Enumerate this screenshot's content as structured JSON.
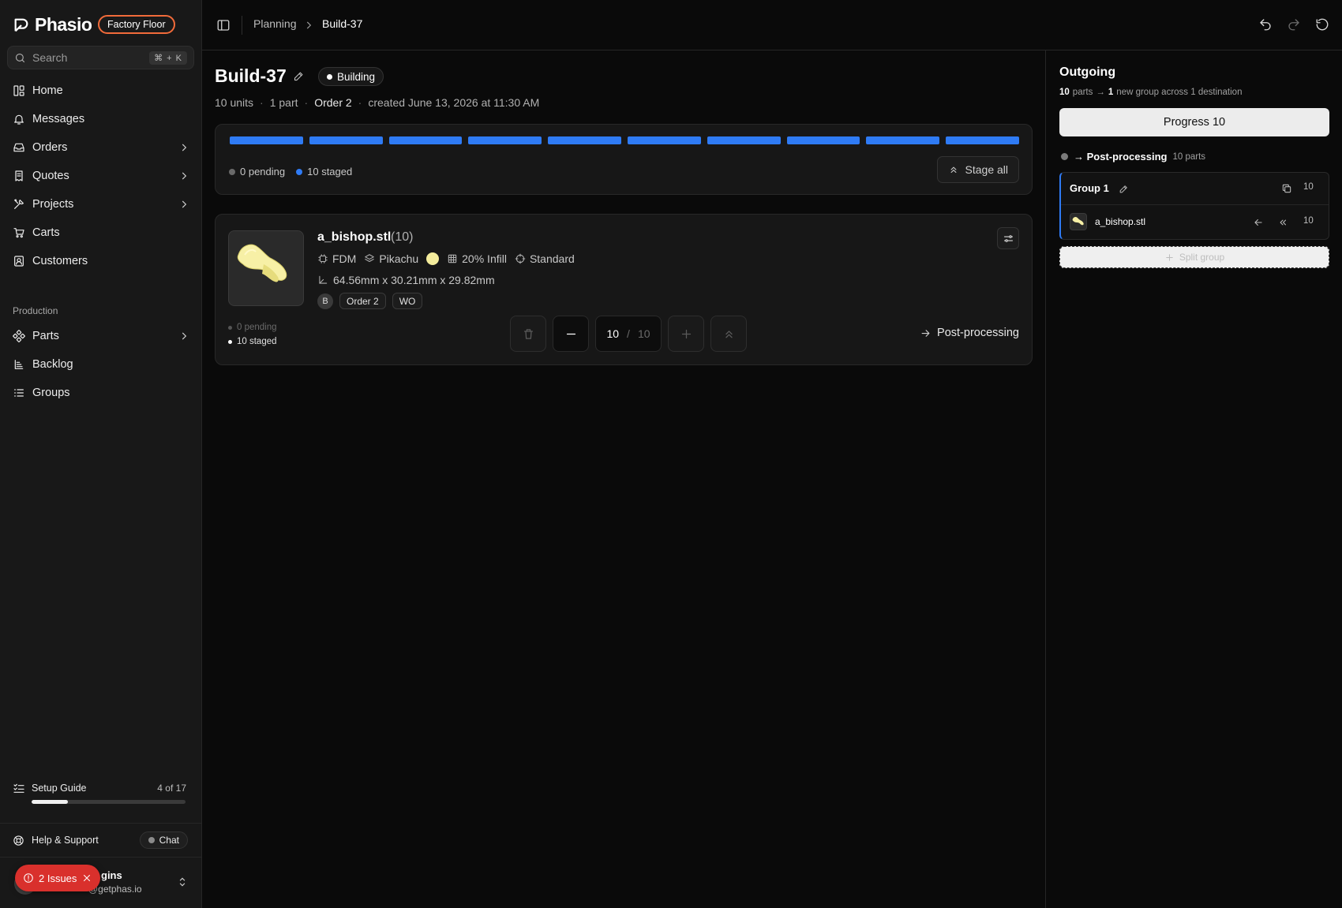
{
  "sidebar": {
    "brand": "Phasio",
    "workspace_badge": "Factory Floor",
    "search": {
      "placeholder": "Search",
      "shortcut": "⌘ + K"
    },
    "nav": [
      {
        "label": "Home",
        "icon": "dashboard-icon",
        "has_children": false
      },
      {
        "label": "Messages",
        "icon": "bell-icon",
        "has_children": false
      },
      {
        "label": "Orders",
        "icon": "inbox-icon",
        "has_children": true
      },
      {
        "label": "Quotes",
        "icon": "receipt-icon",
        "has_children": true
      },
      {
        "label": "Projects",
        "icon": "tools-icon",
        "has_children": true
      },
      {
        "label": "Carts",
        "icon": "cart-icon",
        "has_children": false
      },
      {
        "label": "Customers",
        "icon": "contact-icon",
        "has_children": false
      }
    ],
    "production_label": "Production",
    "production_nav": [
      {
        "label": "Parts",
        "icon": "parts-icon",
        "has_children": true
      },
      {
        "label": "Backlog",
        "icon": "backlog-icon",
        "has_children": false
      },
      {
        "label": "Groups",
        "icon": "list-icon",
        "has_children": false
      }
    ],
    "setup_guide": {
      "label": "Setup Guide",
      "progress_text": "4 of 17",
      "progress_fraction": 0.235
    },
    "help": {
      "label": "Help & Support",
      "chat_label": "Chat"
    },
    "user": {
      "name_visible": "gins",
      "email_visible": "@getphas.io"
    },
    "issues": {
      "label": "2 Issues"
    }
  },
  "topbar": {
    "breadcrumb": [
      "Planning",
      "Build-37"
    ]
  },
  "build": {
    "title": "Build-37",
    "status": "Building",
    "meta": {
      "units": "10 units",
      "parts": "1 part",
      "order": "Order 2",
      "created": "created June 13, 2026 at 11:30 AM"
    },
    "segments_total": 10,
    "segments_staged": 10,
    "colors": {
      "staged": "#2f7bf5",
      "pending": "#6a6a6a",
      "accent_badge": "#f26b3a",
      "issues": "#d9302c"
    },
    "legend": {
      "pending": "0 pending",
      "staged": "10 staged"
    },
    "stage_all_label": "Stage all"
  },
  "part": {
    "name": "a_bishop.stl",
    "qty_label": "(10)",
    "technology": "FDM",
    "material": "Pikachu",
    "color_hex": "#f4ec9c",
    "infill": "20% Infill",
    "quality": "Standard",
    "dimensions": "64.56mm x 30.21mm x 29.82mm",
    "tag_initial": "B",
    "tags": [
      "Order 2",
      "WO"
    ],
    "legend": {
      "pending": "0 pending",
      "staged": "10 staged"
    },
    "quantity_value": "10",
    "quantity_sep": "/",
    "quantity_total": "10",
    "destination": "Post-processing"
  },
  "outgoing": {
    "title": "Outgoing",
    "summary": {
      "parts_count": "10",
      "parts_word": "parts",
      "arrow": "→",
      "groups_count": "1",
      "rest": "new group across 1 destination"
    },
    "progress_button": "Progress 10",
    "destination": {
      "name": "→ Post-processing",
      "count": "10 parts"
    },
    "group": {
      "name": "Group 1",
      "count": "10",
      "item_name": "a_bishop.stl",
      "item_count": "10"
    },
    "split_label": "Split group"
  }
}
